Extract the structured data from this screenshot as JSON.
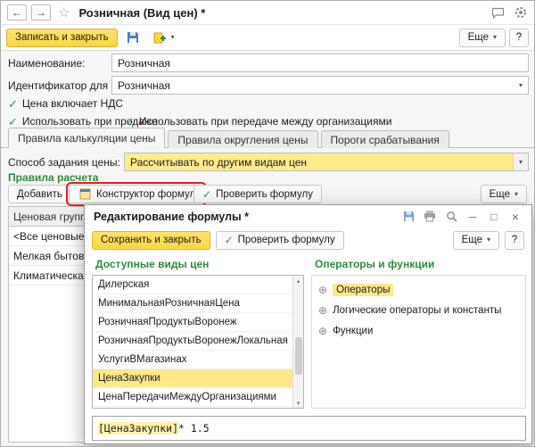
{
  "ui": {
    "back": "←",
    "forward": "→",
    "star": "☆",
    "caret": "▾",
    "check": "✓",
    "minimize": "─",
    "maximize": "□",
    "close": "×",
    "scroll_up": "▴",
    "scroll_down": "▾"
  },
  "titlebar": {
    "title": "Розничная (Вид цен) *"
  },
  "toolbar": {
    "save_close": "Записать и закрыть",
    "more": "Еще",
    "help": "?"
  },
  "form": {
    "name_label": "Наименование:",
    "name_value": "Розничная",
    "id_label": "Идентификатор для формул:",
    "id_value": "Розничная",
    "checkbox_vat": "Цена включает НДС",
    "checkbox_sale": "Использовать при продаже",
    "checkbox_transfer": "Использовать при передаче между организациями"
  },
  "tabs": {
    "calc": "Правила калькуляции цены",
    "rounding": "Правила округления цены",
    "thresholds": "Пороги срабатывания"
  },
  "price_method": {
    "label": "Способ задания цены:",
    "value": "Рассчитывать по другим видам цен"
  },
  "calc_section": {
    "title": "Правила расчета",
    "add": "Добавить",
    "constructor": "Конструктор формул",
    "check": "Проверить формулу",
    "more": "Еще",
    "table_header": "Ценовая группа",
    "rows": [
      "<Все ценовые гру",
      "Мелкая бытовая т",
      "Климатическая те"
    ]
  },
  "dialog": {
    "title": "Редактирование формулы *",
    "save_close": "Сохранить и закрыть",
    "check": "Проверить формулу",
    "more": "Еще",
    "help": "?",
    "left_panel": {
      "title": "Доступные виды цен",
      "items": [
        "Дилерская",
        "МинимальнаяРозничнаяЦена",
        "РозничнаяПродуктыВоронеж",
        "РозничнаяПродуктыВоронежЛокальная",
        "УслугиВМагазинах",
        "ЦенаЗакупки",
        "ЦенаПередачиМеждуОрганизациями"
      ]
    },
    "right_panel": {
      "title": "Операторы и функции",
      "expand": "⊕",
      "items": [
        "Операторы",
        "Логические операторы и константы",
        "Функции"
      ]
    },
    "formula": {
      "token": "[ЦенаЗакупки]",
      "rest": " * 1.5"
    }
  }
}
